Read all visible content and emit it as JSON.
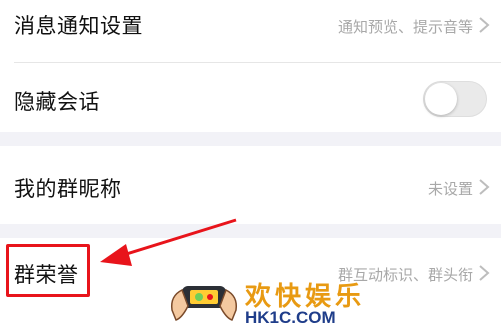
{
  "settings": {
    "notification": {
      "label": "消息通知设置",
      "value": "通知预览、提示音等"
    },
    "hide_chat": {
      "label": "隐藏会话",
      "enabled": false
    },
    "group_nickname": {
      "label": "我的群昵称",
      "value": "未设置"
    },
    "group_honor": {
      "label": "群荣誉",
      "value": "群互动标识、群头衔"
    }
  },
  "annotation": {
    "color": "#e8141b"
  },
  "watermark": {
    "title": "欢快娱乐",
    "site": "HK1C.COM"
  }
}
